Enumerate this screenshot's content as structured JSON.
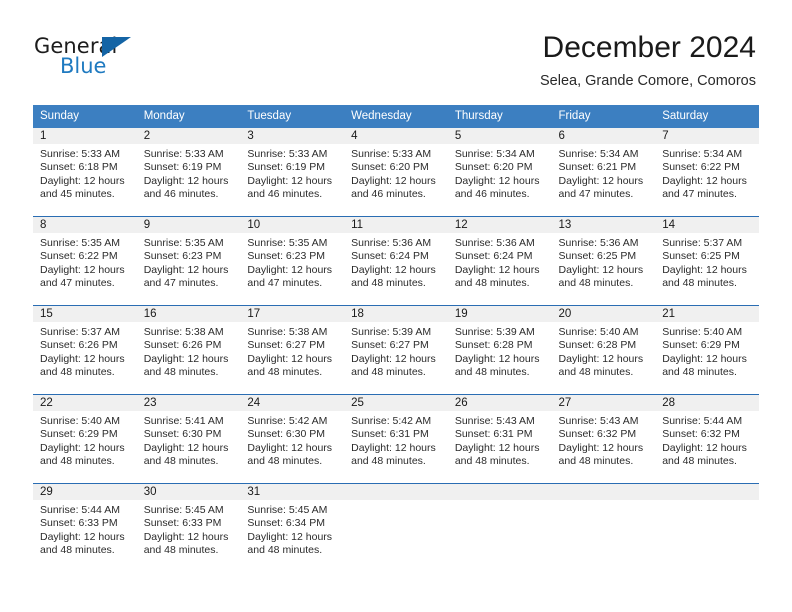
{
  "brand": {
    "word_general": "General",
    "word_blue": "Blue",
    "flag_icon": "triangle-flag-icon"
  },
  "header": {
    "title": "December 2024",
    "subtitle": "Selea, Grande Comore, Comoros"
  },
  "colors": {
    "header_row": "#3c7fc1",
    "row_divider": "#2a6db3",
    "daynum_band": "#f0f0f0",
    "brand_blue": "#1f7ac0",
    "flag_blue": "#1464a5",
    "text": "#1a1a1a"
  },
  "weekday_headers": [
    "Sunday",
    "Monday",
    "Tuesday",
    "Wednesday",
    "Thursday",
    "Friday",
    "Saturday"
  ],
  "labels": {
    "sunrise_prefix": "Sunrise:",
    "sunset_prefix": "Sunset:",
    "daylight_prefix": "Daylight:"
  },
  "weeks": [
    [
      {
        "day": "1",
        "sunrise": "Sunrise: 5:33 AM",
        "sunset": "Sunset: 6:18 PM",
        "daylight_1": "Daylight: 12 hours",
        "daylight_2": "and 45 minutes."
      },
      {
        "day": "2",
        "sunrise": "Sunrise: 5:33 AM",
        "sunset": "Sunset: 6:19 PM",
        "daylight_1": "Daylight: 12 hours",
        "daylight_2": "and 46 minutes."
      },
      {
        "day": "3",
        "sunrise": "Sunrise: 5:33 AM",
        "sunset": "Sunset: 6:19 PM",
        "daylight_1": "Daylight: 12 hours",
        "daylight_2": "and 46 minutes."
      },
      {
        "day": "4",
        "sunrise": "Sunrise: 5:33 AM",
        "sunset": "Sunset: 6:20 PM",
        "daylight_1": "Daylight: 12 hours",
        "daylight_2": "and 46 minutes."
      },
      {
        "day": "5",
        "sunrise": "Sunrise: 5:34 AM",
        "sunset": "Sunset: 6:20 PM",
        "daylight_1": "Daylight: 12 hours",
        "daylight_2": "and 46 minutes."
      },
      {
        "day": "6",
        "sunrise": "Sunrise: 5:34 AM",
        "sunset": "Sunset: 6:21 PM",
        "daylight_1": "Daylight: 12 hours",
        "daylight_2": "and 47 minutes."
      },
      {
        "day": "7",
        "sunrise": "Sunrise: 5:34 AM",
        "sunset": "Sunset: 6:22 PM",
        "daylight_1": "Daylight: 12 hours",
        "daylight_2": "and 47 minutes."
      }
    ],
    [
      {
        "day": "8",
        "sunrise": "Sunrise: 5:35 AM",
        "sunset": "Sunset: 6:22 PM",
        "daylight_1": "Daylight: 12 hours",
        "daylight_2": "and 47 minutes."
      },
      {
        "day": "9",
        "sunrise": "Sunrise: 5:35 AM",
        "sunset": "Sunset: 6:23 PM",
        "daylight_1": "Daylight: 12 hours",
        "daylight_2": "and 47 minutes."
      },
      {
        "day": "10",
        "sunrise": "Sunrise: 5:35 AM",
        "sunset": "Sunset: 6:23 PM",
        "daylight_1": "Daylight: 12 hours",
        "daylight_2": "and 47 minutes."
      },
      {
        "day": "11",
        "sunrise": "Sunrise: 5:36 AM",
        "sunset": "Sunset: 6:24 PM",
        "daylight_1": "Daylight: 12 hours",
        "daylight_2": "and 48 minutes."
      },
      {
        "day": "12",
        "sunrise": "Sunrise: 5:36 AM",
        "sunset": "Sunset: 6:24 PM",
        "daylight_1": "Daylight: 12 hours",
        "daylight_2": "and 48 minutes."
      },
      {
        "day": "13",
        "sunrise": "Sunrise: 5:36 AM",
        "sunset": "Sunset: 6:25 PM",
        "daylight_1": "Daylight: 12 hours",
        "daylight_2": "and 48 minutes."
      },
      {
        "day": "14",
        "sunrise": "Sunrise: 5:37 AM",
        "sunset": "Sunset: 6:25 PM",
        "daylight_1": "Daylight: 12 hours",
        "daylight_2": "and 48 minutes."
      }
    ],
    [
      {
        "day": "15",
        "sunrise": "Sunrise: 5:37 AM",
        "sunset": "Sunset: 6:26 PM",
        "daylight_1": "Daylight: 12 hours",
        "daylight_2": "and 48 minutes."
      },
      {
        "day": "16",
        "sunrise": "Sunrise: 5:38 AM",
        "sunset": "Sunset: 6:26 PM",
        "daylight_1": "Daylight: 12 hours",
        "daylight_2": "and 48 minutes."
      },
      {
        "day": "17",
        "sunrise": "Sunrise: 5:38 AM",
        "sunset": "Sunset: 6:27 PM",
        "daylight_1": "Daylight: 12 hours",
        "daylight_2": "and 48 minutes."
      },
      {
        "day": "18",
        "sunrise": "Sunrise: 5:39 AM",
        "sunset": "Sunset: 6:27 PM",
        "daylight_1": "Daylight: 12 hours",
        "daylight_2": "and 48 minutes."
      },
      {
        "day": "19",
        "sunrise": "Sunrise: 5:39 AM",
        "sunset": "Sunset: 6:28 PM",
        "daylight_1": "Daylight: 12 hours",
        "daylight_2": "and 48 minutes."
      },
      {
        "day": "20",
        "sunrise": "Sunrise: 5:40 AM",
        "sunset": "Sunset: 6:28 PM",
        "daylight_1": "Daylight: 12 hours",
        "daylight_2": "and 48 minutes."
      },
      {
        "day": "21",
        "sunrise": "Sunrise: 5:40 AM",
        "sunset": "Sunset: 6:29 PM",
        "daylight_1": "Daylight: 12 hours",
        "daylight_2": "and 48 minutes."
      }
    ],
    [
      {
        "day": "22",
        "sunrise": "Sunrise: 5:40 AM",
        "sunset": "Sunset: 6:29 PM",
        "daylight_1": "Daylight: 12 hours",
        "daylight_2": "and 48 minutes."
      },
      {
        "day": "23",
        "sunrise": "Sunrise: 5:41 AM",
        "sunset": "Sunset: 6:30 PM",
        "daylight_1": "Daylight: 12 hours",
        "daylight_2": "and 48 minutes."
      },
      {
        "day": "24",
        "sunrise": "Sunrise: 5:42 AM",
        "sunset": "Sunset: 6:30 PM",
        "daylight_1": "Daylight: 12 hours",
        "daylight_2": "and 48 minutes."
      },
      {
        "day": "25",
        "sunrise": "Sunrise: 5:42 AM",
        "sunset": "Sunset: 6:31 PM",
        "daylight_1": "Daylight: 12 hours",
        "daylight_2": "and 48 minutes."
      },
      {
        "day": "26",
        "sunrise": "Sunrise: 5:43 AM",
        "sunset": "Sunset: 6:31 PM",
        "daylight_1": "Daylight: 12 hours",
        "daylight_2": "and 48 minutes."
      },
      {
        "day": "27",
        "sunrise": "Sunrise: 5:43 AM",
        "sunset": "Sunset: 6:32 PM",
        "daylight_1": "Daylight: 12 hours",
        "daylight_2": "and 48 minutes."
      },
      {
        "day": "28",
        "sunrise": "Sunrise: 5:44 AM",
        "sunset": "Sunset: 6:32 PM",
        "daylight_1": "Daylight: 12 hours",
        "daylight_2": "and 48 minutes."
      }
    ],
    [
      {
        "day": "29",
        "sunrise": "Sunrise: 5:44 AM",
        "sunset": "Sunset: 6:33 PM",
        "daylight_1": "Daylight: 12 hours",
        "daylight_2": "and 48 minutes."
      },
      {
        "day": "30",
        "sunrise": "Sunrise: 5:45 AM",
        "sunset": "Sunset: 6:33 PM",
        "daylight_1": "Daylight: 12 hours",
        "daylight_2": "and 48 minutes."
      },
      {
        "day": "31",
        "sunrise": "Sunrise: 5:45 AM",
        "sunset": "Sunset: 6:34 PM",
        "daylight_1": "Daylight: 12 hours",
        "daylight_2": "and 48 minutes."
      },
      {
        "day": "",
        "sunrise": "",
        "sunset": "",
        "daylight_1": "",
        "daylight_2": ""
      },
      {
        "day": "",
        "sunrise": "",
        "sunset": "",
        "daylight_1": "",
        "daylight_2": ""
      },
      {
        "day": "",
        "sunrise": "",
        "sunset": "",
        "daylight_1": "",
        "daylight_2": ""
      },
      {
        "day": "",
        "sunrise": "",
        "sunset": "",
        "daylight_1": "",
        "daylight_2": ""
      }
    ]
  ]
}
